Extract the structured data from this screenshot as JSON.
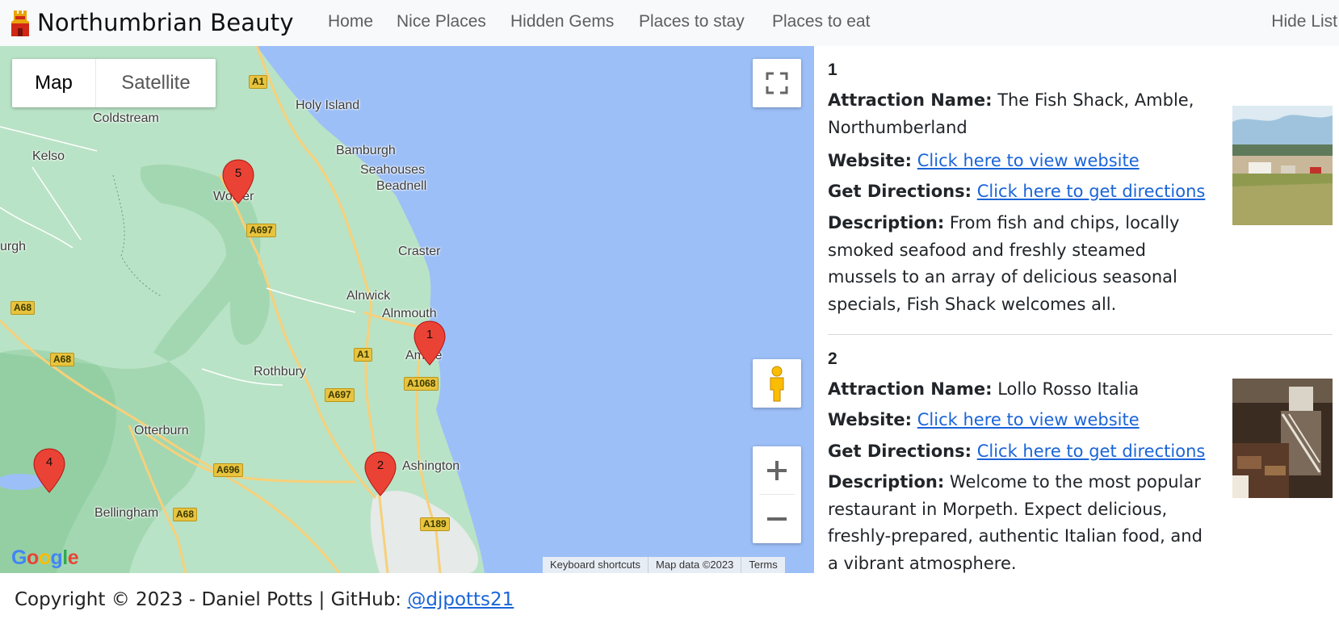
{
  "navbar": {
    "brand": "Northumbrian Beauty",
    "links": [
      "Home",
      "Nice Places",
      "Hidden Gems",
      "Places to stay",
      "Places to eat"
    ],
    "toggle": "Hide List"
  },
  "map": {
    "type_buttons": {
      "map": "Map",
      "satellite": "Satellite"
    },
    "places": [
      "Holy Island",
      "Coldstream",
      "Kelso",
      "Bamburgh",
      "Seahouses",
      "Beadnell",
      "Wooler",
      "urgh",
      "Craster",
      "Alnwick",
      "Alnmouth",
      "Amble",
      "Rothbury",
      "Otterburn",
      "Ashington",
      "Bellingham"
    ],
    "roads": [
      "A1",
      "A697",
      "A68",
      "A68",
      "A1",
      "A1068",
      "A697",
      "A696",
      "A68",
      "A189"
    ],
    "markers": [
      "1",
      "2",
      "4",
      "5"
    ],
    "logo": "Google",
    "attribution": [
      "Keyboard shortcuts",
      "Map data ©2023",
      "Terms"
    ],
    "icons": [
      "fullscreen-icon",
      "pegman-icon",
      "plus-icon",
      "minus-icon"
    ]
  },
  "labels": {
    "name": "Attraction Name:",
    "website": "Website:",
    "directions": "Get Directions:",
    "description": "Description:"
  },
  "attractions": [
    {
      "num": "1",
      "name": "The Fish Shack, Amble, Northumberland",
      "website_link": "Click here to view website",
      "directions_link": "Click here to get directions",
      "description": "From fish and chips, locally smoked seafood and freshly steamed mussels to an array of delicious seasonal specials, Fish Shack welcomes all."
    },
    {
      "num": "2",
      "name": "Lollo Rosso Italia",
      "website_link": "Click here to view website",
      "directions_link": "Click here to get directions",
      "description": "Welcome to the most popular restaurant in Morpeth. Expect delicious, freshly-prepared, authentic Italian food, and a vibrant atmosphere."
    }
  ],
  "footer": {
    "text": "Copyright © 2023 - Daniel Potts | GitHub: ",
    "link": "@djpotts21"
  }
}
